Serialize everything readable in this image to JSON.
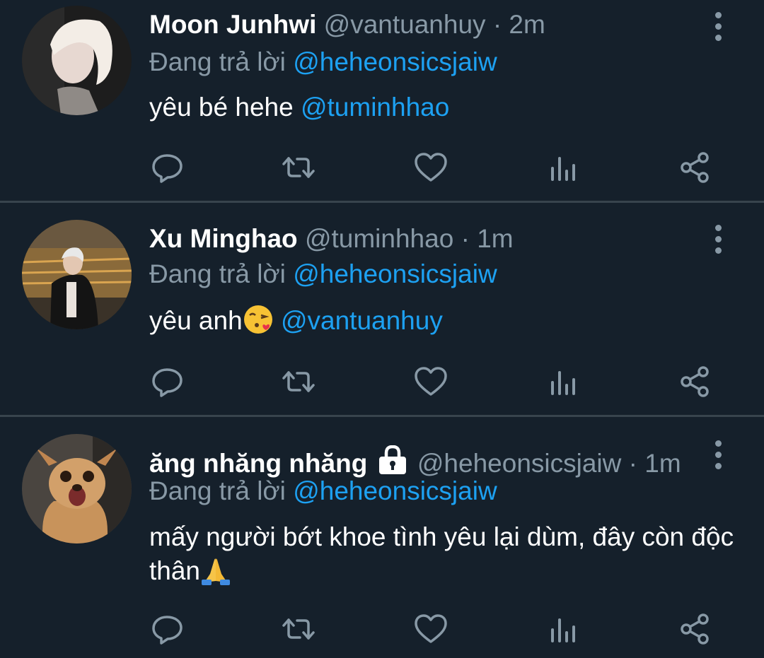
{
  "tweets": [
    {
      "display_name": "Moon Junhwi",
      "handle": "@vantuanhuy",
      "separator": "·",
      "time": "2m",
      "replying_prefix": "Đang trả lời",
      "replying_to": "@heheonsicsjaiw",
      "text": "yêu bé hehe ",
      "mention": "@tuminhhao"
    },
    {
      "display_name": "Xu Minghao",
      "handle": "@tuminhhao",
      "separator": "·",
      "time": "1m",
      "replying_prefix": "Đang trả lời",
      "replying_to": "@heheonsicsjaiw",
      "text": "yêu anh",
      "emoji": "kissing-face-with-heart",
      "mention": "@vantuanhuy"
    },
    {
      "display_name": "ăng nhăng nhăng",
      "protected_icon": "lock-icon",
      "handle": "@heheonsicsjaiw",
      "separator": "·",
      "time": "1m",
      "replying_prefix": "Đang trả lời",
      "replying_to": "@heheonsicsjaiw",
      "text": "mấy người bớt khoe tình yêu lại dùm, đây còn độc thân",
      "emoji": "folded-hands"
    }
  ],
  "action_icons": [
    "reply-icon",
    "retweet-icon",
    "like-icon",
    "analytics-icon",
    "share-icon"
  ],
  "colors": {
    "background": "#15202b",
    "divider": "#38444d",
    "secondary_text": "#8899a6",
    "accent": "#1da1f2"
  }
}
